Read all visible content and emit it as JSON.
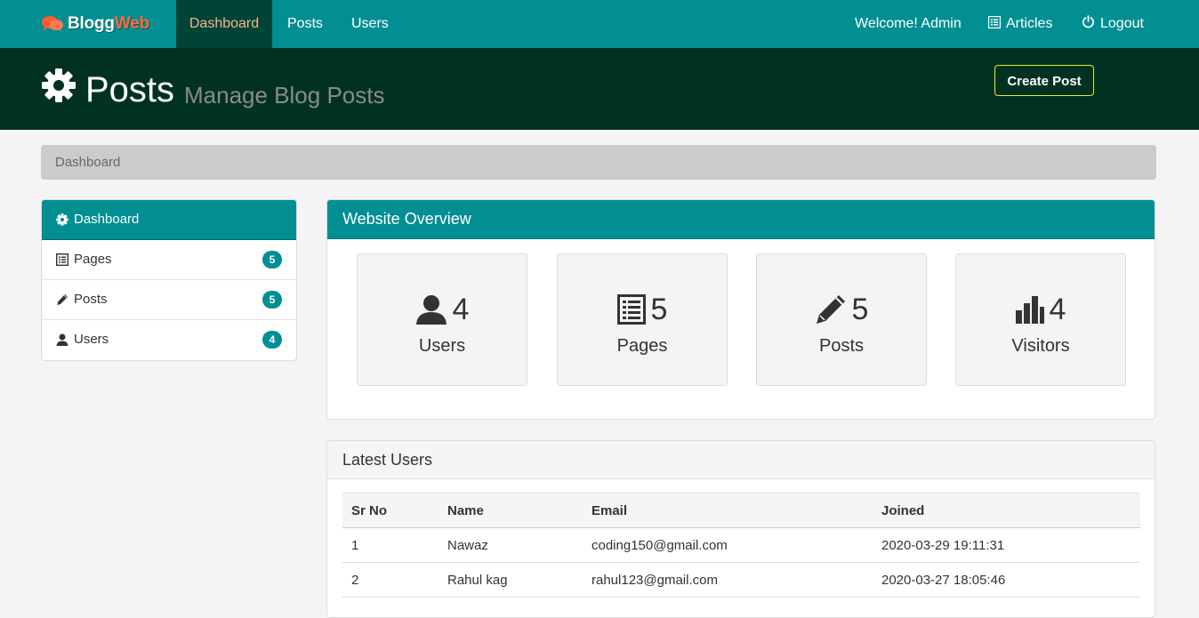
{
  "brand": {
    "name_part1": "Blogg",
    "name_part2": "Web"
  },
  "nav": {
    "items": [
      {
        "label": "Dashboard",
        "active": true
      },
      {
        "label": "Posts",
        "active": false
      },
      {
        "label": "Users",
        "active": false
      }
    ],
    "welcome": "Welcome! Admin",
    "articles": "Articles",
    "logout": "Logout"
  },
  "header": {
    "title": "Posts",
    "subtitle": "Manage Blog Posts",
    "create_button": "Create Post"
  },
  "breadcrumb": "Dashboard",
  "sidebar": {
    "items": [
      {
        "label": "Dashboard",
        "icon": "gear-icon",
        "badge": null,
        "active": true
      },
      {
        "label": "Pages",
        "icon": "list-icon",
        "badge": "5",
        "active": false
      },
      {
        "label": "Posts",
        "icon": "pencil-icon",
        "badge": "5",
        "active": false
      },
      {
        "label": "Users",
        "icon": "user-icon",
        "badge": "4",
        "active": false
      }
    ]
  },
  "overview": {
    "title": "Website Overview",
    "stats": [
      {
        "count": "4",
        "label": "Users",
        "icon": "user-icon"
      },
      {
        "count": "5",
        "label": "Pages",
        "icon": "list-icon"
      },
      {
        "count": "5",
        "label": "Posts",
        "icon": "pencil-icon"
      },
      {
        "count": "4",
        "label": "Visitors",
        "icon": "bar-chart-icon"
      }
    ]
  },
  "latest_users": {
    "title": "Latest Users",
    "columns": [
      "Sr No",
      "Name",
      "Email",
      "Joined"
    ],
    "rows": [
      [
        "1",
        "Nawaz",
        "coding150@gmail.com",
        "2020-03-29 19:11:31"
      ],
      [
        "2",
        "Rahul kag",
        "rahul123@gmail.com",
        "2020-03-27 18:05:46"
      ]
    ]
  },
  "colors": {
    "primary": "#028f93",
    "header_bg": "#013221",
    "nav_active_bg": "#004438",
    "nav_active_text": "#f7b28f",
    "button_border": "#e8e832"
  }
}
